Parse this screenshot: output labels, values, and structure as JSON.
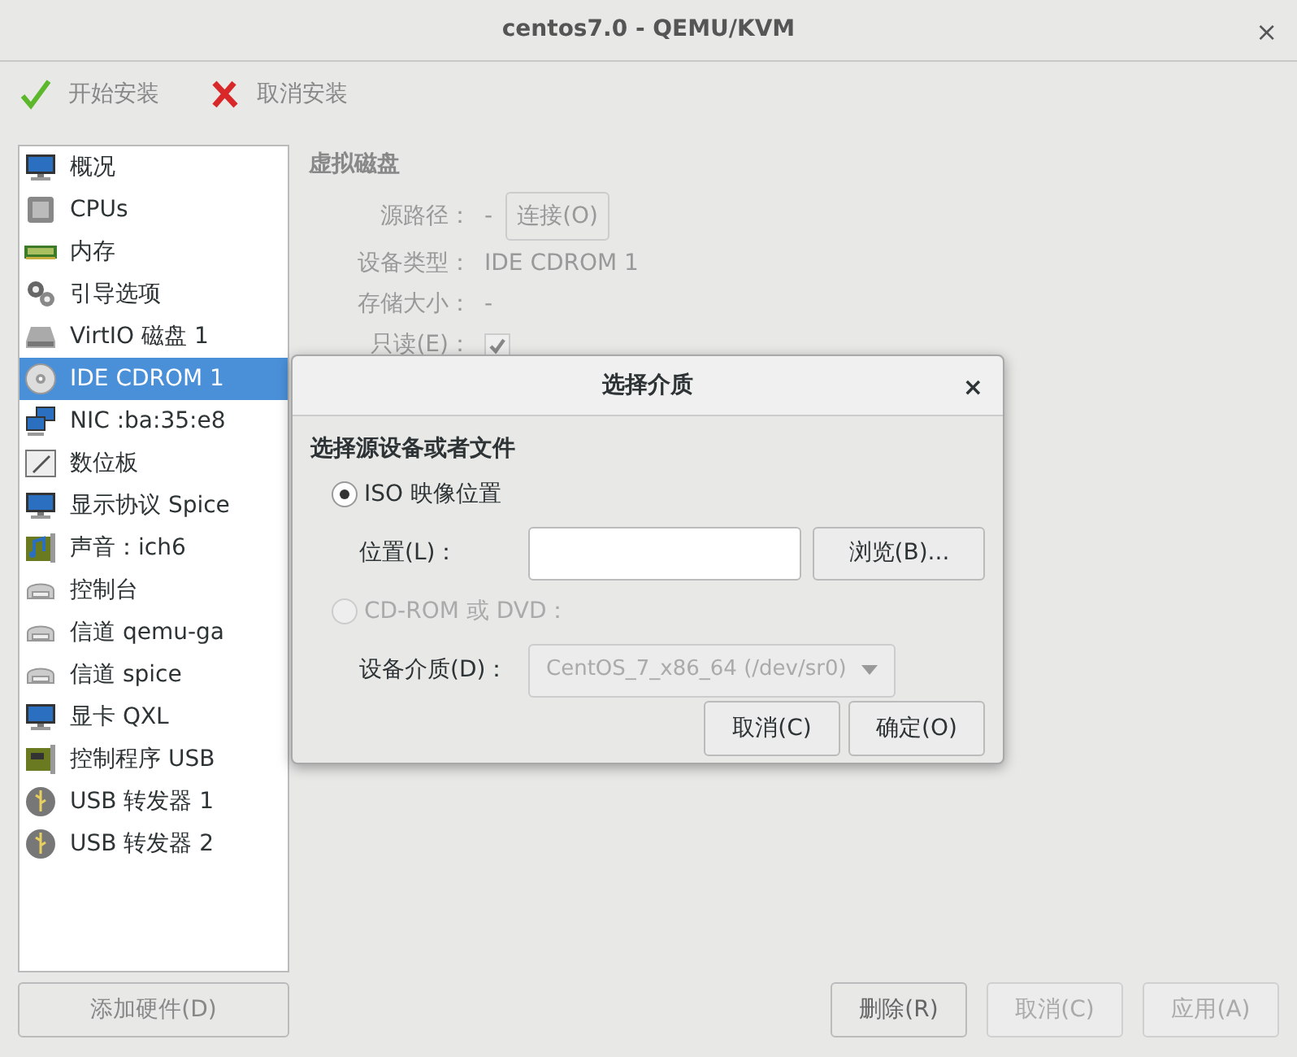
{
  "window": {
    "title": "centos7.0 - QEMU/KVM",
    "close": "×"
  },
  "toolbar": [
    {
      "kind": "check",
      "label": "开始安装"
    },
    {
      "kind": "cross",
      "label": "取消安装"
    }
  ],
  "sidebar": {
    "items": [
      {
        "kind": "monitor",
        "label": "概况",
        "selected": false
      },
      {
        "kind": "cpu",
        "label": "CPUs",
        "selected": false
      },
      {
        "kind": "memory",
        "label": "内存",
        "selected": false
      },
      {
        "kind": "gears",
        "label": "引导选项",
        "selected": false
      },
      {
        "kind": "disk",
        "label": "VirtIO 磁盘 1",
        "selected": false
      },
      {
        "kind": "cdrom",
        "label": "IDE CDROM 1",
        "selected": true
      },
      {
        "kind": "nic",
        "label": "NIC :ba:35:e8",
        "selected": false
      },
      {
        "kind": "tablet",
        "label": "数位板",
        "selected": false
      },
      {
        "kind": "monitor",
        "label": "显示协议 Spice",
        "selected": false
      },
      {
        "kind": "sound",
        "label": "声音：ich6",
        "selected": false
      },
      {
        "kind": "serial",
        "label": "控制台",
        "selected": false
      },
      {
        "kind": "serial",
        "label": "信道 qemu-ga",
        "selected": false
      },
      {
        "kind": "serial",
        "label": "信道 spice",
        "selected": false
      },
      {
        "kind": "monitor",
        "label": "显卡 QXL",
        "selected": false
      },
      {
        "kind": "card",
        "label": "控制程序 USB",
        "selected": false
      },
      {
        "kind": "usb",
        "label": "USB 转发器 1",
        "selected": false
      },
      {
        "kind": "usb",
        "label": "USB 转发器 2",
        "selected": false
      }
    ]
  },
  "add_hardware_button": "添加硬件(D)",
  "details": {
    "heading": "虚拟磁盘",
    "source_path": {
      "label": "源路径：",
      "value": "-",
      "button": "连接(O)"
    },
    "device_type": {
      "label": "设备类型：",
      "value": "IDE CDROM 1"
    },
    "storage_size": {
      "label": "存储大小：",
      "value": "-"
    },
    "readonly": {
      "label": "只读(E)：",
      "checked": true
    }
  },
  "footer_buttons": [
    {
      "label": "删除(R)",
      "disabled": false
    },
    {
      "label": "取消(C)",
      "disabled": true
    },
    {
      "label": "应用(A)",
      "disabled": true
    }
  ],
  "dialog": {
    "title": "选择介质",
    "close": "×",
    "heading": "选择源设备或者文件",
    "options": [
      {
        "label": "ISO 映像位置",
        "selected": true,
        "disabled": false
      },
      {
        "label": "CD-ROM 或 DVD：",
        "selected": false,
        "disabled": true
      }
    ],
    "location": {
      "label": "位置(L)：",
      "browse_button": "浏览(B)..."
    },
    "device_media": {
      "label": "设备介质(D)：",
      "value": "CentOS_7_x86_64 (/dev/sr0)",
      "disabled": true
    },
    "buttons": [
      "取消(C)",
      "确定(O)"
    ]
  }
}
